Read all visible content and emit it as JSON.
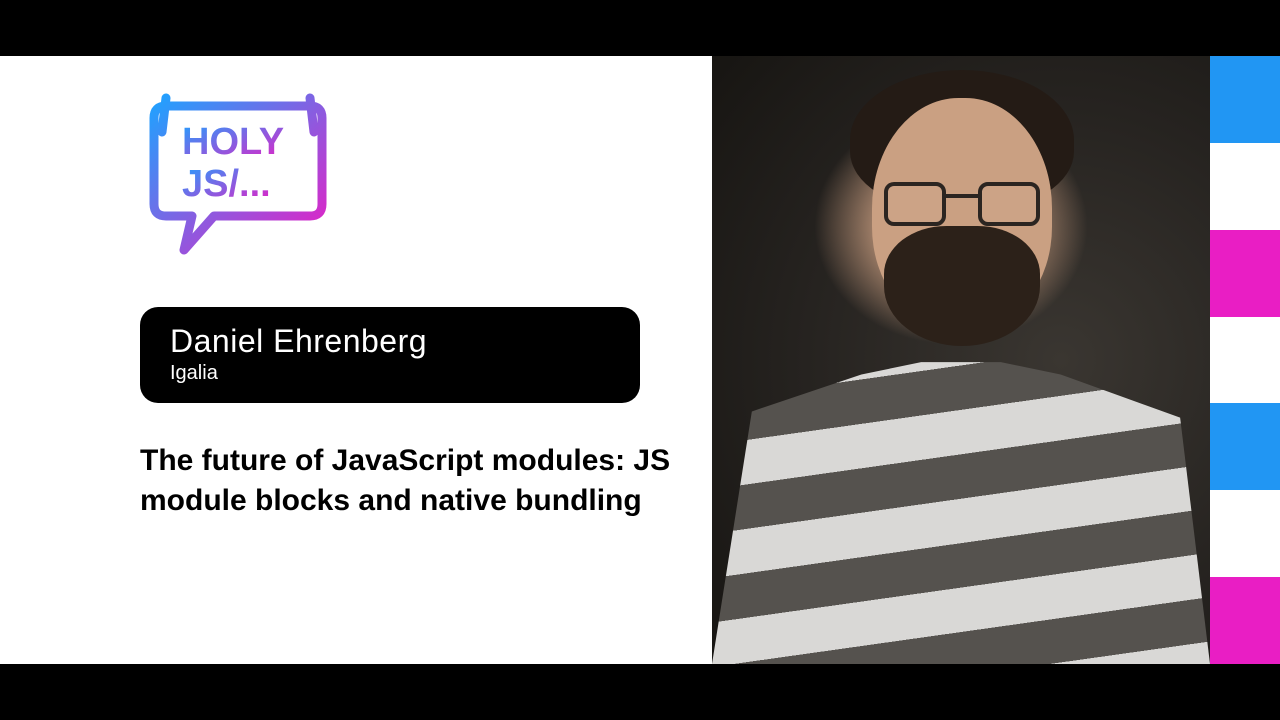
{
  "event": {
    "logo_line1": "HOLY",
    "logo_line2": "JS/..."
  },
  "speaker": {
    "name": "Daniel Ehrenberg",
    "company": "Igalia"
  },
  "talk": {
    "title": "The future of JavaScript modules: JS module blocks and native bundling"
  },
  "colors": {
    "stripe_blue": "#2196f3",
    "stripe_white": "#ffffff",
    "stripe_magenta": "#e91ec4",
    "gradient_start": "#1fa2ff",
    "gradient_end": "#e91ec4"
  },
  "stripes": [
    "blue",
    "white",
    "magenta",
    "white",
    "blue",
    "white",
    "magenta"
  ]
}
